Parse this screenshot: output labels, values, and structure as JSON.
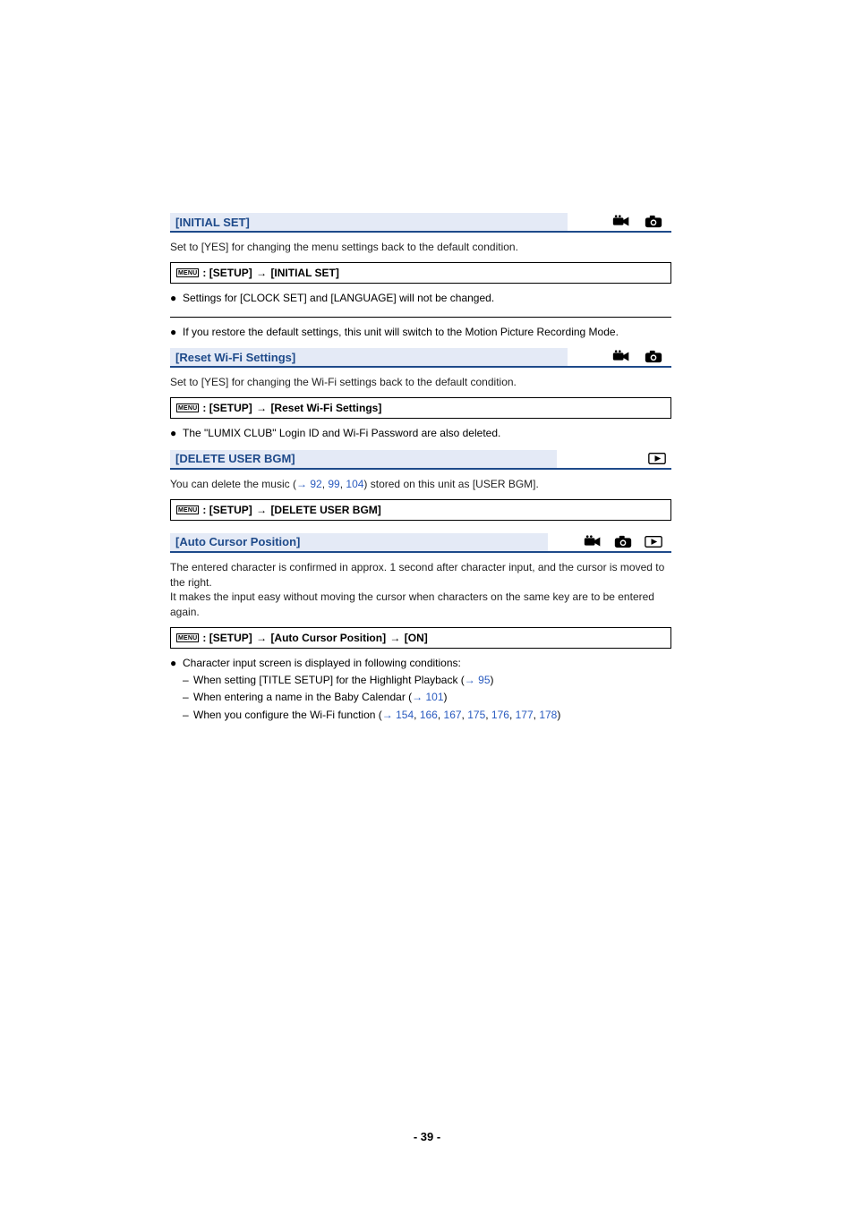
{
  "menu_label": "MENU",
  "sections": {
    "initial_set": {
      "title": "[INITIAL SET]",
      "desc": "Set to [YES] for changing the menu settings back to the default condition.",
      "path_colon": " : ",
      "path_part1": "[SETUP]",
      "path_arrow": " → ",
      "path_part2": "[INITIAL SET]",
      "bullet1": "Settings for [CLOCK SET] and [LANGUAGE] will not be changed.",
      "bullet2": "If you restore the default settings, this unit will switch to the Motion Picture Recording Mode."
    },
    "reset_wifi": {
      "title": "[Reset Wi-Fi Settings]",
      "desc": "Set to [YES] for changing the Wi-Fi settings back to the default condition.",
      "path_colon": " : ",
      "path_part1": "[SETUP]",
      "path_arrow": " → ",
      "path_part2": "[Reset Wi-Fi Settings]",
      "bullet1": "The \"LUMIX CLUB\" Login ID and Wi-Fi Password are also deleted."
    },
    "delete_bgm": {
      "title": "[DELETE USER BGM]",
      "desc_pre": "You can delete the music (",
      "desc_arrow": "→ ",
      "link_92": "92",
      "comma1": ", ",
      "link_99": "99",
      "comma2": ", ",
      "link_104": "104",
      "desc_post": ") stored on this unit as [USER BGM].",
      "path_colon": " : ",
      "path_part1": "[SETUP]",
      "path_arrow": " → ",
      "path_part2": "[DELETE USER BGM]"
    },
    "auto_cursor": {
      "title": "[Auto Cursor Position]",
      "desc": "The entered character is confirmed in approx. 1 second after character input, and the cursor is moved to the right.\nIt makes the input easy without moving the cursor when characters on the same key are to be entered again.",
      "path_colon": " : ",
      "path_part1": "[SETUP]",
      "path_arrow1": " → ",
      "path_part2": "[Auto Cursor Position]",
      "path_arrow2": " → ",
      "path_part3": "[ON]",
      "bullet1": "Character input screen is displayed in following conditions:",
      "sub1_pre": "When setting [TITLE SETUP] for the Highlight Playback (",
      "sub1_arrow": "→ ",
      "sub1_link": "95",
      "sub1_post": ")",
      "sub2_pre": "When entering a name in the Baby Calendar (",
      "sub2_arrow": "→ ",
      "sub2_link": "101",
      "sub2_post": ")",
      "sub3_pre": "When you configure the Wi-Fi function (",
      "sub3_arrow": "→ ",
      "sub3_l1": "154",
      "sub3_c1": ", ",
      "sub3_l2": "166",
      "sub3_c2": ", ",
      "sub3_l3": "167",
      "sub3_c3": ", ",
      "sub3_l4": "175",
      "sub3_c4": ", ",
      "sub3_l5": "176",
      "sub3_c5": ", ",
      "sub3_l6": "177",
      "sub3_c6": ", ",
      "sub3_l7": "178",
      "sub3_post": ")"
    }
  },
  "page_number": "- 39 -"
}
